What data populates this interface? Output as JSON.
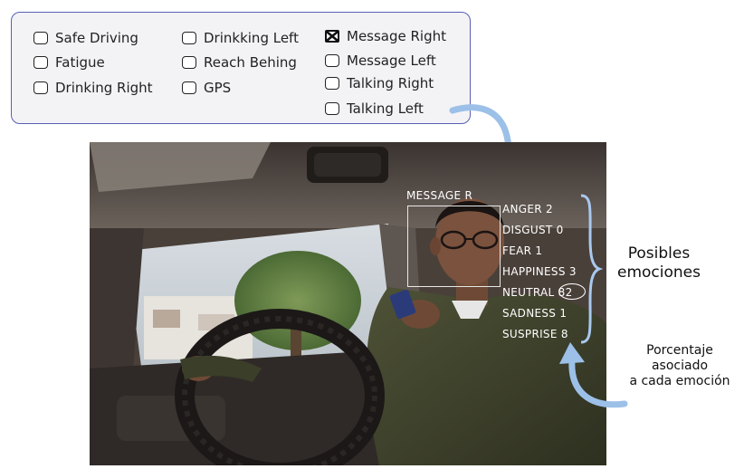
{
  "legend": {
    "items": [
      {
        "label": "Safe Driving",
        "checked": false
      },
      {
        "label": "Fatigue",
        "checked": false
      },
      {
        "label": "Drinking Right",
        "checked": false
      },
      {
        "label": "Drinkking Left",
        "checked": false
      },
      {
        "label": "Reach Behing",
        "checked": false
      },
      {
        "label": "GPS",
        "checked": false
      },
      {
        "label": "Message Right",
        "checked": true
      },
      {
        "label": "Message Left",
        "checked": false
      },
      {
        "label": "Talking Right",
        "checked": false
      },
      {
        "label": "Talking Left",
        "checked": false
      }
    ]
  },
  "photo": {
    "detected_class": "MESSAGE R",
    "emotions": [
      {
        "label": "ANGER",
        "value": "2"
      },
      {
        "label": "DISGUST",
        "value": "0"
      },
      {
        "label": "FEAR",
        "value": "1"
      },
      {
        "label": "HAPPINESS",
        "value": "3"
      },
      {
        "label": "NEUTRAL",
        "value": "82"
      },
      {
        "label": "SADNESS",
        "value": "1"
      },
      {
        "label": "SUSPRISE",
        "value": "8"
      }
    ]
  },
  "annotations": {
    "emotions_title_line1": "Posibles",
    "emotions_title_line2": "emociones",
    "percent_line1": "Porcentaje",
    "percent_line2": "asociado",
    "percent_line3": "a cada emoción"
  },
  "colors": {
    "panel_border": "#5a5fb4",
    "arrow": "#9cc0e8",
    "brace": "#a9c8ee"
  }
}
